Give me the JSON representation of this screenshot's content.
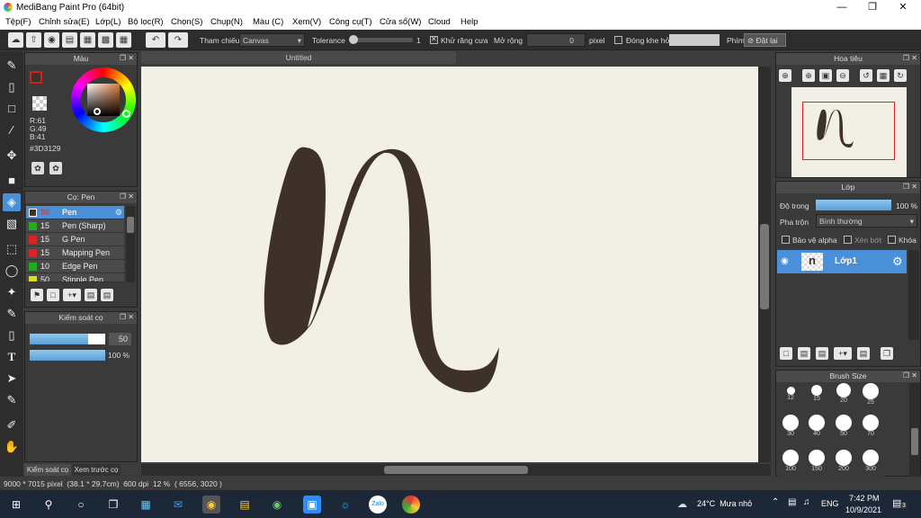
{
  "window": {
    "title": "MediBang Paint Pro (64bit)"
  },
  "menu": [
    "Tệp(F)",
    "Chỉnh sửa(E)",
    "Lớp(L)",
    "Bộ lọc(R)",
    "Chọn(S)",
    "Chụp(N)",
    "Màu (C)",
    "Xem(V)",
    "Công cụ(T)",
    "Cửa sổ(W)",
    "Cloud",
    "Help"
  ],
  "toolbar": {
    "ref_label": "Tham chiếu",
    "ref_value": "Canvas",
    "tolerance_label": "Tolerance",
    "tolerance_value": "1",
    "antialias_label": "Khử răng cưa",
    "expand_label": "Mở rộng",
    "expand_value": "0",
    "expand_unit": "pixel",
    "gap_label": "Đóng khe hở",
    "key_label": "Phím",
    "reset_label": "Đặt lại"
  },
  "color_panel": {
    "title": "Màu",
    "r": "R:61",
    "g": "G:49",
    "b": "B:41",
    "hex": "#3D3129",
    "primary": "#3D3129",
    "accent_outline": "#cc2222"
  },
  "brush_panel": {
    "title": "Cọ: Pen",
    "brushes": [
      {
        "size": "50",
        "name": "Pen",
        "color": "#3D3129",
        "selected": true
      },
      {
        "size": "15",
        "name": "Pen (Sharp)",
        "color": "#22aa22"
      },
      {
        "size": "15",
        "name": "G Pen",
        "color": "#dd2222"
      },
      {
        "size": "15",
        "name": "Mapping Pen",
        "color": "#dd2222"
      },
      {
        "size": "10",
        "name": "Edge Pen",
        "color": "#22aa22"
      },
      {
        "size": "50",
        "name": "Stipple Pen",
        "color": "#dddd22"
      }
    ]
  },
  "brush_control": {
    "title": "Kiểm soát cọ",
    "size_value": "50",
    "opacity_value": "100 %",
    "size_fraction": 0.77,
    "opacity_fraction": 1.0
  },
  "bottom_tabs": [
    "Kiểm soát cọ",
    "Xem trước cọ"
  ],
  "canvas": {
    "tab_title": "Untitled",
    "bg": "#f2f0e6"
  },
  "navigator": {
    "title": "Hoa tiêu"
  },
  "layer_panel": {
    "title": "Lớp",
    "opacity_label": "Độ trong",
    "opacity_value": "100 %",
    "blend_label": "Pha trộn",
    "blend_value": "Bình thường",
    "protect_alpha": "Bảo vệ alpha",
    "clip": "Xén bớt",
    "lock": "Khóa",
    "layer_name": "Lớp1"
  },
  "brush_size_panel": {
    "title": "Brush Size",
    "sizes": [
      "12",
      "15",
      "20",
      "25",
      "30",
      "40",
      "50",
      "70",
      "100",
      "150",
      "200",
      "300"
    ]
  },
  "status": {
    "text": "9000 * 7015 pixel  (38.1 * 29.7cm)  600 dpi  12 %  ( 6556, 3020 )"
  },
  "taskbar": {
    "weather": "24°C  Mưa nhỏ",
    "lang": "ENG",
    "time": "7:42 PM",
    "date": "10/9/2021",
    "notif_count": "3"
  }
}
